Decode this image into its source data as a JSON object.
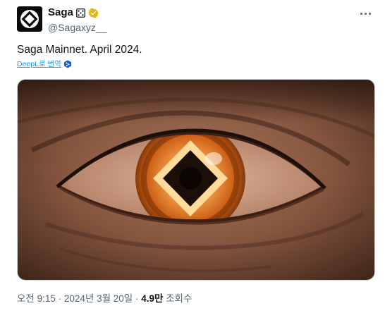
{
  "tweet": {
    "author": {
      "display_name": "Saga",
      "handle": "@Sagaxyz__",
      "avatar_icon": "saga-logo-icon",
      "emoji_icon": "dice-emoji-icon",
      "verified_icon": "verified-badge-icon",
      "verified_color": "#e2b719"
    },
    "text": "Saga Mainnet. April 2024.",
    "translate_label": "DeepL로 번역",
    "translate_icon": "deepl-icon",
    "media_alt": "eye-with-saga-logo-iris",
    "meta": {
      "time": "오전 9:15",
      "separator": " · ",
      "date": "2024년 3월 20일",
      "views_count": "4.9만",
      "views_label": " 조회수"
    },
    "more_icon": "more-options-icon",
    "colors": {
      "link": "#1d9bf0",
      "muted": "#536471",
      "text": "#0f1419"
    }
  }
}
